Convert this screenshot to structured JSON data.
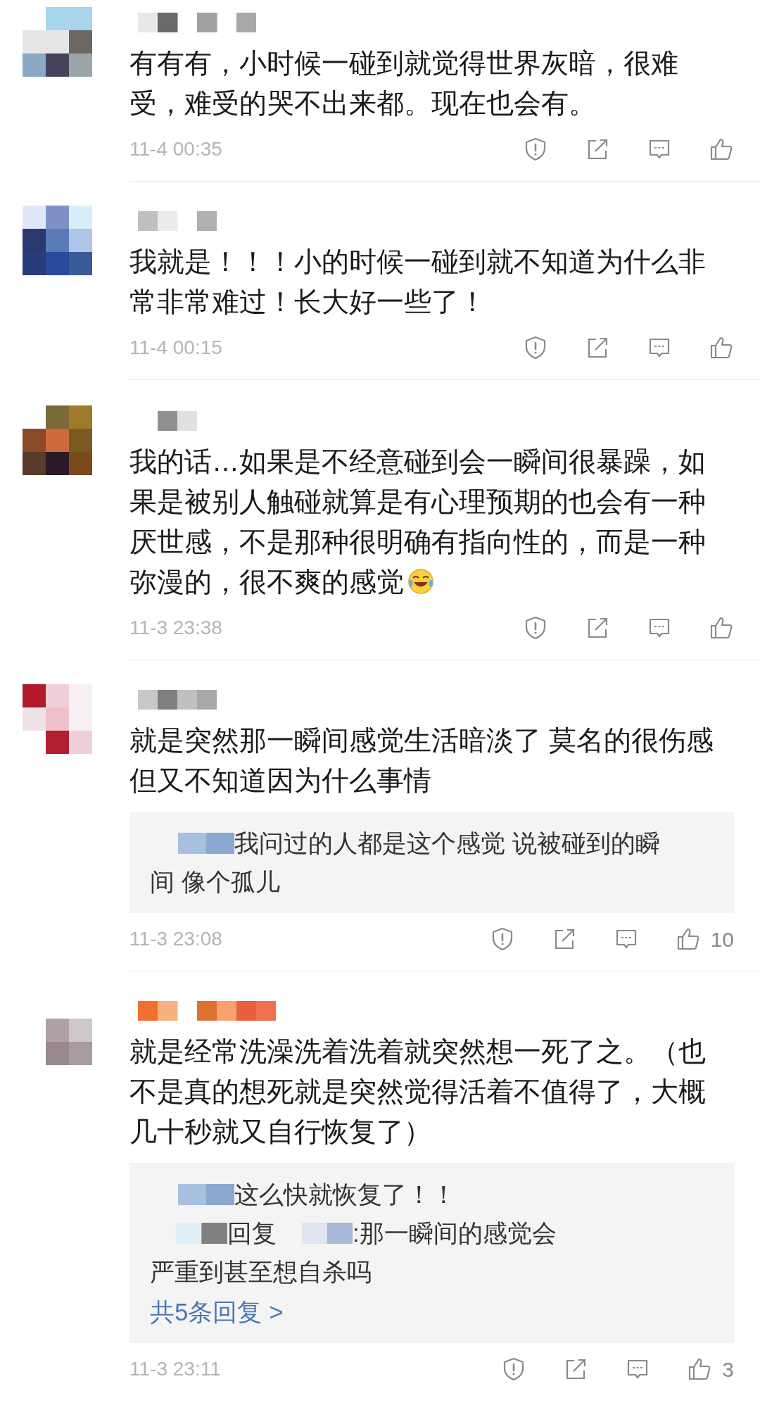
{
  "comments": [
    {
      "body": [
        {
          "kind": "text",
          "text": "有有有，小时候一碰到就觉得世界灰暗，很难受，难受的哭不出来都。现在也会有。"
        }
      ],
      "time": "11-4 00:35"
    },
    {
      "body": [
        {
          "kind": "text",
          "text": "我就是！！！小的时候一碰到就不知道为什么非常非常难过！长大好一些了！"
        }
      ],
      "time": "11-4 00:15"
    },
    {
      "body": [
        {
          "kind": "text",
          "text": "我的话…如果是不经意碰到会一瞬间很暴躁，如果是被别人触碰就算是有心理预期的也会有一种厌世感，不是那种很明确有指向性的，而是一种"
        },
        {
          "kind": "text",
          "text": "弥漫的，很不爽的感觉"
        },
        {
          "kind": "laughing_emoji"
        }
      ],
      "time": "11-3 23:38"
    },
    {
      "body": [
        {
          "kind": "text",
          "text": "就是突然那一瞬间感觉生活暗淡了 莫名的很伤感但又不知道因为什么事情"
        }
      ],
      "replies": [
        [
          [
            {
              "kind": "redacted"
            },
            {
              "kind": "text",
              "text": "我问过的人都是这个感觉 说被碰到的瞬"
            }
          ],
          [
            {
              "kind": "text",
              "text": "间 像个孤儿"
            }
          ]
        ]
      ],
      "time": "11-3 23:08",
      "likes": "10"
    },
    {
      "body": [
        {
          "kind": "text",
          "text": "就是经常洗澡洗着洗着就突然想一死了之。（也不是真的想死就是突然觉得活着不值得了，大概几十秒就又自行恢复了）"
        }
      ],
      "replies": [
        [
          [
            {
              "kind": "redacted"
            },
            {
              "kind": "text",
              "text": "这么快就恢复了！！"
            }
          ]
        ],
        [
          [
            {
              "kind": "redacted"
            },
            {
              "kind": "text",
              "text": "回复"
            },
            {
              "kind": "redacted"
            },
            {
              "kind": "text",
              "text": ":那一瞬间的感觉会"
            }
          ],
          [
            {
              "kind": "text",
              "text": "严重到甚至想自杀吗"
            }
          ]
        ]
      ],
      "more": "共5条回复 >",
      "time": "11-3 23:11",
      "likes": "3"
    }
  ]
}
